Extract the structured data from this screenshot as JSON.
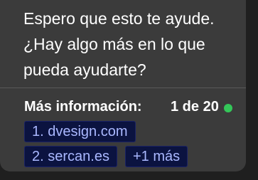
{
  "message": {
    "line1": "Espero que esto te ayude.",
    "line2": "¿Hay algo más en lo que",
    "line3": "pueda ayudarte?"
  },
  "sources": {
    "heading": "Más información:",
    "counter": "1 de 20",
    "status_color": "#34c759",
    "links": [
      {
        "label": "1. dvesign.com"
      },
      {
        "label": "2. sercan.es"
      }
    ],
    "more_label": "+1 más"
  },
  "colors": {
    "card_bg": "#3b3b3b",
    "chip_bg": "#0b1340",
    "chip_text": "#aab8ff"
  }
}
